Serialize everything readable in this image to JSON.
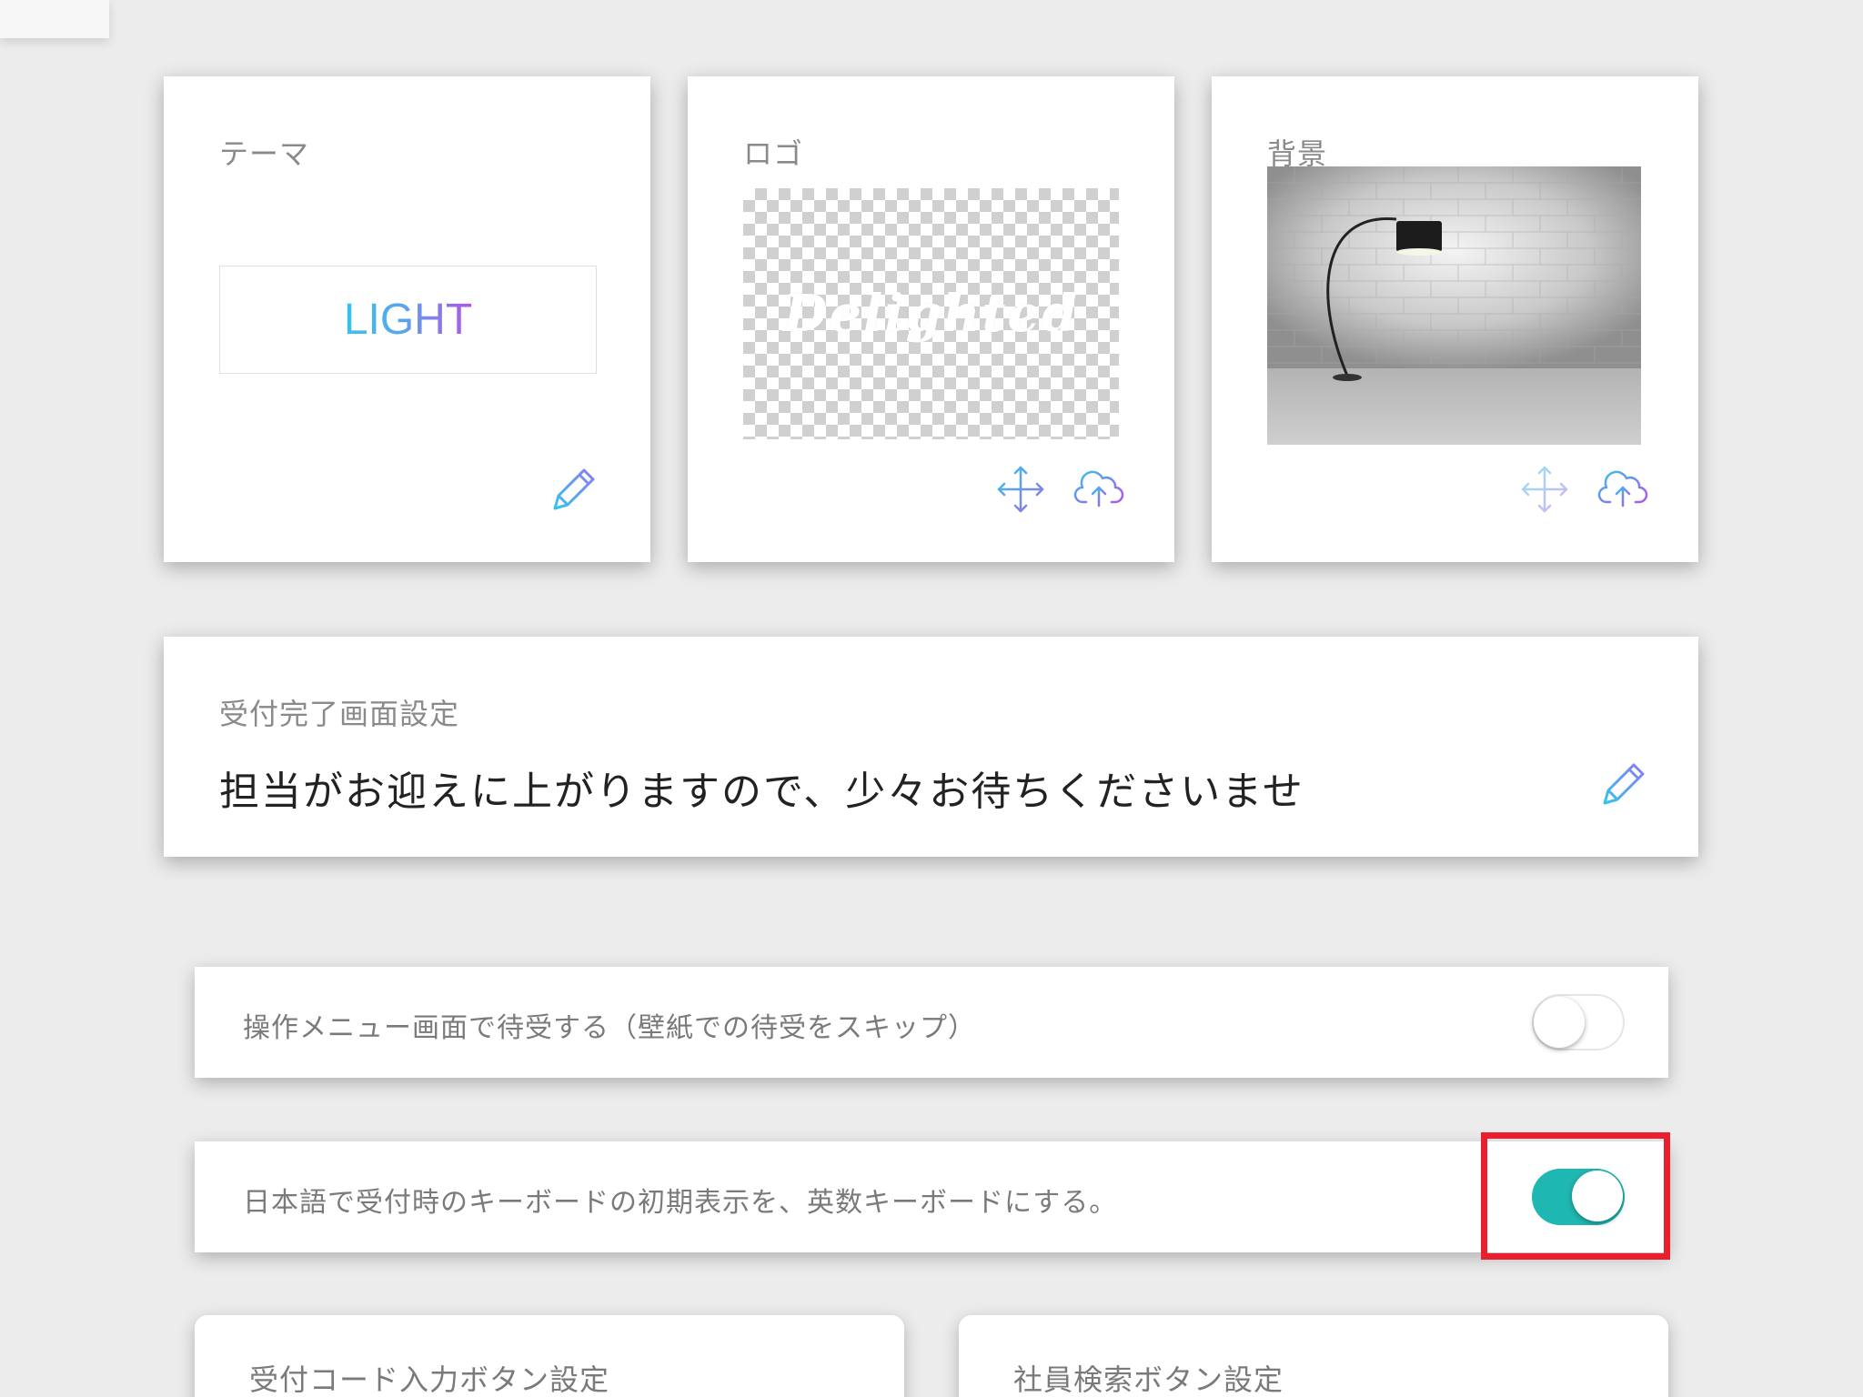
{
  "theme_card": {
    "title": "テーマ",
    "value": "LIGHT",
    "edit_icon": "pencil-icon"
  },
  "logo_card": {
    "title": "ロゴ",
    "logo_text": "Delighted",
    "move_icon": "move-arrows-icon",
    "upload_icon": "cloud-upload-icon"
  },
  "background_card": {
    "title": "背景",
    "image_subject": "floor lamp in front of white brick wall",
    "move_icon": "move-arrows-icon",
    "upload_icon": "cloud-upload-icon"
  },
  "completion_card": {
    "title": "受付完了画面設定",
    "message": "担当がお迎えに上がりますので、少々お待ちくださいませ",
    "edit_icon": "pencil-icon"
  },
  "settings": [
    {
      "label": "操作メニュー画面で待受する（壁紙での待受をスキップ）",
      "enabled": false
    },
    {
      "label": "日本語で受付時のキーボードの初期表示を、英数キーボードにする。",
      "enabled": true
    }
  ],
  "bottom_cards": {
    "code_button_title": "受付コード入力ボタン設定",
    "employee_search_title": "社員検索ボタン設定"
  },
  "colors": {
    "accent_start": "#35c3ee",
    "accent_end": "#b155e6",
    "toggle_on": "#1fb7b1",
    "highlight": "#e8202e",
    "background": "#ececec"
  }
}
